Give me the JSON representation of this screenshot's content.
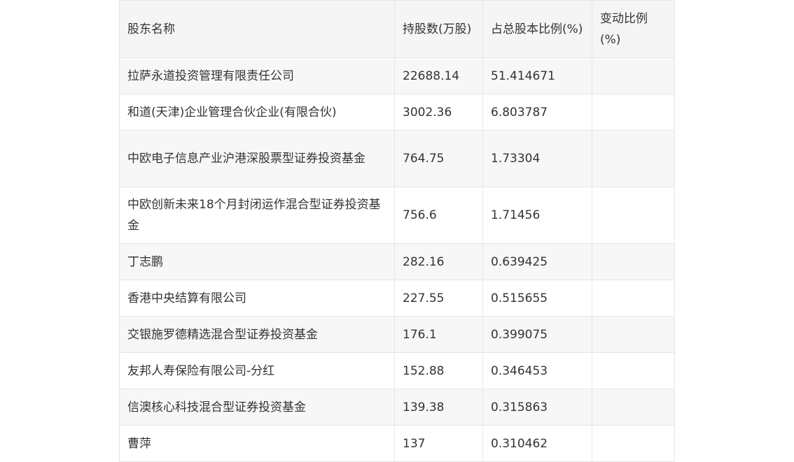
{
  "table": {
    "headers": [
      "股东名称",
      "持股数(万股)",
      "占总股本比例(%)",
      "变动比例(%)"
    ],
    "rows": [
      {
        "name": "拉萨永道投资管理有限责任公司",
        "shares": "22688.14",
        "ratio": "51.414671",
        "change": ""
      },
      {
        "name": "和道(天津)企业管理合伙企业(有限合伙)",
        "shares": "3002.36",
        "ratio": "6.803787",
        "change": ""
      },
      {
        "name": "中欧电子信息产业沪港深股票型证券投资基金",
        "shares": "764.75",
        "ratio": "1.73304",
        "change": ""
      },
      {
        "name": "中欧创新未来18个月封闭运作混合型证券投资基金",
        "shares": "756.6",
        "ratio": "1.71456",
        "change": ""
      },
      {
        "name": "丁志鹏",
        "shares": "282.16",
        "ratio": "0.639425",
        "change": ""
      },
      {
        "name": "香港中央结算有限公司",
        "shares": "227.55",
        "ratio": "0.515655",
        "change": ""
      },
      {
        "name": "交银施罗德精选混合型证券投资基金",
        "shares": "176.1",
        "ratio": "0.399075",
        "change": ""
      },
      {
        "name": "友邦人寿保险有限公司-分红",
        "shares": "152.88",
        "ratio": "0.346453",
        "change": ""
      },
      {
        "name": "信澳核心科技混合型证券投资基金",
        "shares": "139.38",
        "ratio": "0.315863",
        "change": ""
      },
      {
        "name": "曹萍",
        "shares": "137",
        "ratio": "0.310462",
        "change": ""
      }
    ]
  }
}
